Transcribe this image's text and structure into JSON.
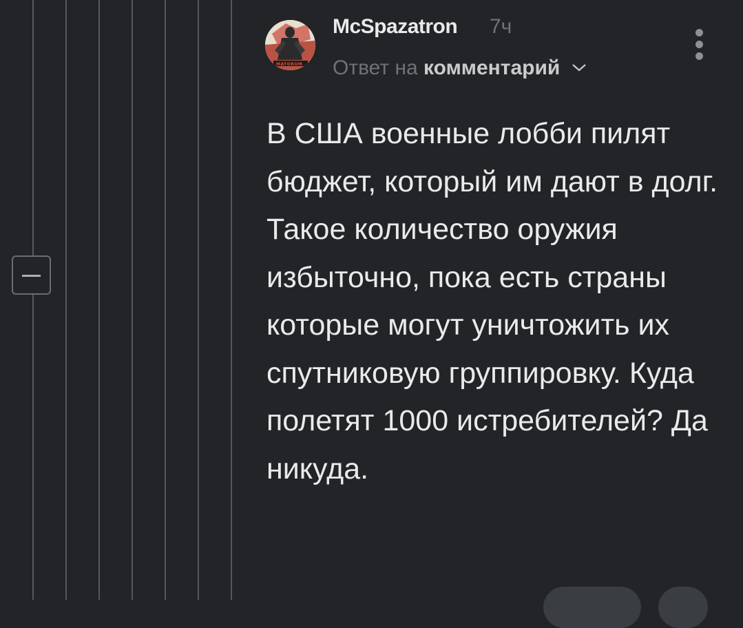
{
  "thread": {
    "collapse_icon": "minus-square-icon"
  },
  "comment": {
    "author": "McSpazatron",
    "time": "7ч",
    "reply_prefix": "Ответ на",
    "reply_link": "комментарий",
    "reply_icon": "chevron-down-icon",
    "menu_icon": "vertical-dots-icon",
    "avatar_icon": "user-avatar",
    "avatar_caption": "MATORUM",
    "body": "В США военные лобби пилят бюджет, который им дают в долг. Такое количество оружия избыточно, пока есть страны которые могут уничтожить их спутниковую группировку. Куда полетят 1000 истребителей? Да никуда."
  },
  "actions": {
    "pill_1_icon": "action-pill",
    "pill_2_icon": "action-pill"
  }
}
